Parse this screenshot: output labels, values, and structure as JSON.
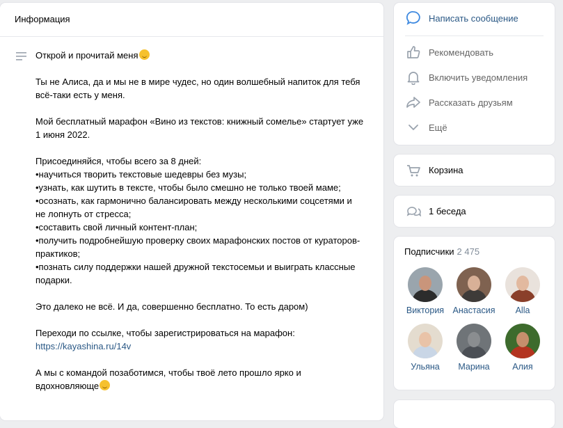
{
  "info": {
    "title": "Информация",
    "lines": [
      "Открой и прочитай меня",
      "",
      "Ты не Алиса, да и мы не в мире чудес, но один волшебный напиток для тебя",
      "всё-таки есть у меня.",
      "",
      "Мой бесплатный марафон «Вино из текстов: книжный сомелье» стартует уже",
      "1 июня 2022.",
      "",
      "Присоединяйся, чтобы всего за 8 дней:",
      "•научиться творить текстовые шедевры без музы;",
      "•узнать, как шутить в тексте, чтобы было смешно не только твоей маме;",
      "•осознать, как гармонично балансировать между несколькими соцсетями и",
      "не лопнуть от стресса;",
      "•составить свой личный контент-план;",
      "•получить подробнейшую проверку своих марафонских постов от кураторов-",
      "практиков;",
      "•познать силу поддержки нашей дружной текстосемьи и выиграть классные",
      "подарки.",
      "",
      "Это далеко не всё. И да, совершенно бесплатно. То есть даром)",
      "",
      "Переходи по ссылке, чтобы зарегистрироваться на марафон:"
    ],
    "link": "https://kayashina.ru/14v",
    "closing_1": "А мы с командой позаботимся, чтобы твоё лето прошло ярко и",
    "closing_2": "вдохновляюще"
  },
  "actions": {
    "write": "Написать сообщение",
    "recommend": "Рекомендовать",
    "notify": "Включить уведомления",
    "share": "Рассказать друзьям",
    "more": "Ещё"
  },
  "cart": {
    "label": "Корзина"
  },
  "chats": {
    "label": "1 беседа"
  },
  "subscribers": {
    "title": "Подписчики",
    "count": "2 475",
    "members": [
      {
        "name": "Виктория",
        "bg": "#9aa5ad",
        "face": "#c9957b",
        "body": "#2c2c2c"
      },
      {
        "name": "Анастасия",
        "bg": "#7f6250",
        "face": "#d8b097",
        "body": "#3e3b39"
      },
      {
        "name": "Alla",
        "bg": "#e9e2dc",
        "face": "#e2b99f",
        "body": "#8a3f2a"
      },
      {
        "name": "Ульяна",
        "bg": "#e4dccf",
        "face": "#e9c3a8",
        "body": "#c9d6e6"
      },
      {
        "name": "Марина",
        "bg": "#6f7478",
        "face": "#8a8d90",
        "body": "#4b4f55"
      },
      {
        "name": "Алия",
        "bg": "#3d6b2d",
        "face": "#c58f6c",
        "body": "#b3341f"
      }
    ]
  }
}
